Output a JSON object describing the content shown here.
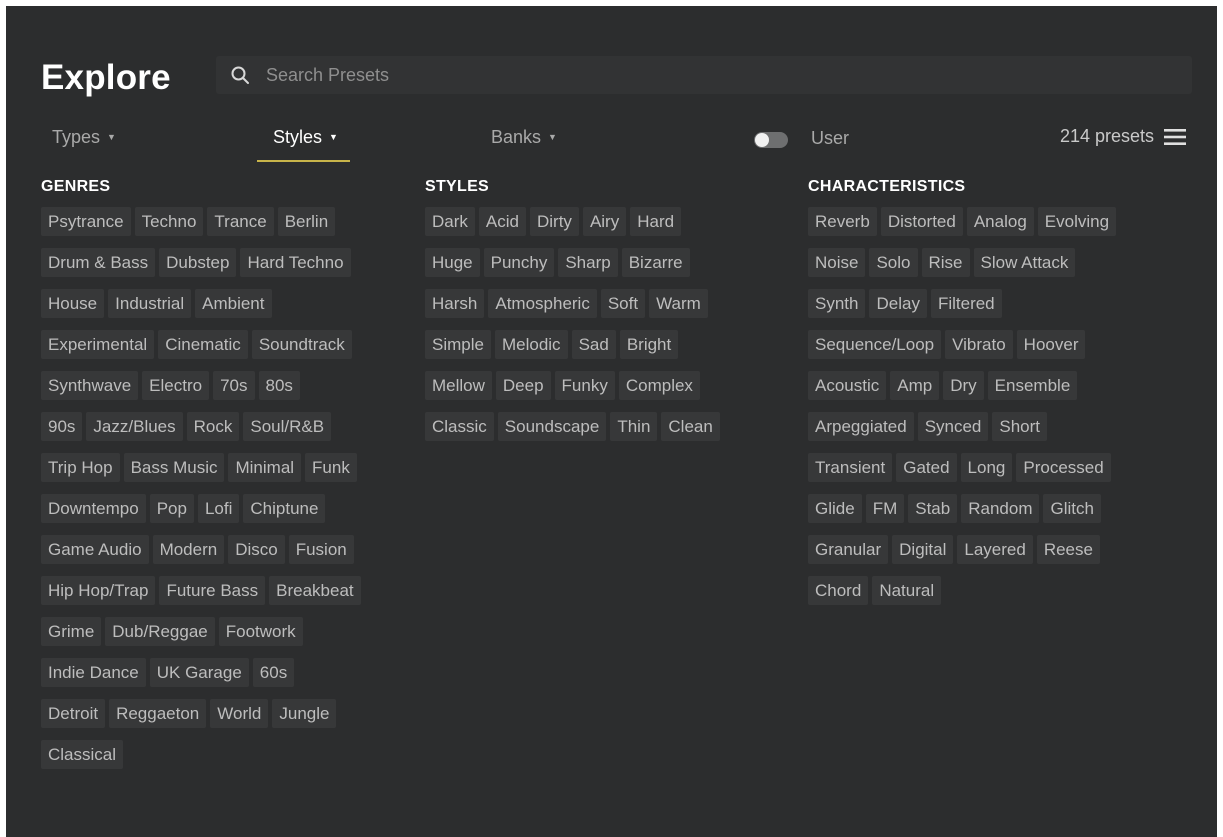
{
  "header": {
    "title": "Explore",
    "search_placeholder": "Search Presets"
  },
  "filters": {
    "types": "Types",
    "styles": "Styles",
    "banks": "Banks",
    "active": "Styles"
  },
  "user_toggle": {
    "label": "User",
    "on": false
  },
  "preset_count": "214 presets",
  "colors": {
    "background": "#2c2d2e",
    "tag_background": "#373839",
    "accent_underline": "#c8b44a"
  },
  "columns": {
    "genres": {
      "heading": "GENRES",
      "rows": [
        [
          "Psytrance",
          "Techno",
          "Trance",
          "Berlin"
        ],
        [
          "Drum & Bass",
          "Dubstep",
          "Hard Techno"
        ],
        [
          "House",
          "Industrial",
          "Ambient"
        ],
        [
          "Experimental",
          "Cinematic",
          "Soundtrack"
        ],
        [
          "Synthwave",
          "Electro",
          "70s",
          "80s"
        ],
        [
          "90s",
          "Jazz/Blues",
          "Rock",
          "Soul/R&B"
        ],
        [
          "Trip Hop",
          "Bass Music",
          "Minimal",
          "Funk"
        ],
        [
          "Downtempo",
          "Pop",
          "Lofi",
          "Chiptune"
        ],
        [
          "Game Audio",
          "Modern",
          "Disco",
          "Fusion"
        ],
        [
          "Hip Hop/Trap",
          "Future Bass",
          "Breakbeat"
        ],
        [
          "Grime",
          "Dub/Reggae",
          "Footwork"
        ],
        [
          "Indie Dance",
          "UK Garage",
          "60s"
        ],
        [
          "Detroit",
          "Reggaeton",
          "World",
          "Jungle"
        ],
        [
          "Classical"
        ]
      ]
    },
    "styles": {
      "heading": "STYLES",
      "rows": [
        [
          "Dark",
          "Acid",
          "Dirty",
          "Airy",
          "Hard"
        ],
        [
          "Huge",
          "Punchy",
          "Sharp",
          "Bizarre"
        ],
        [
          "Harsh",
          "Atmospheric",
          "Soft",
          "Warm"
        ],
        [
          "Simple",
          "Melodic",
          "Sad",
          "Bright"
        ],
        [
          "Mellow",
          "Deep",
          "Funky",
          "Complex"
        ],
        [
          "Classic",
          "Soundscape",
          "Thin",
          "Clean"
        ]
      ]
    },
    "characteristics": {
      "heading": "CHARACTERISTICS",
      "rows": [
        [
          "Reverb",
          "Distorted",
          "Analog",
          "Evolving"
        ],
        [
          "Noise",
          "Solo",
          "Rise",
          "Slow Attack"
        ],
        [
          "Synth",
          "Delay",
          "Filtered"
        ],
        [
          "Sequence/Loop",
          "Vibrato",
          "Hoover"
        ],
        [
          "Acoustic",
          "Amp",
          "Dry",
          "Ensemble"
        ],
        [
          "Arpeggiated",
          "Synced",
          "Short"
        ],
        [
          "Transient",
          "Gated",
          "Long",
          "Processed"
        ],
        [
          "Glide",
          "FM",
          "Stab",
          "Random",
          "Glitch"
        ],
        [
          "Granular",
          "Digital",
          "Layered",
          "Reese"
        ],
        [
          "Chord",
          "Natural"
        ]
      ]
    }
  }
}
